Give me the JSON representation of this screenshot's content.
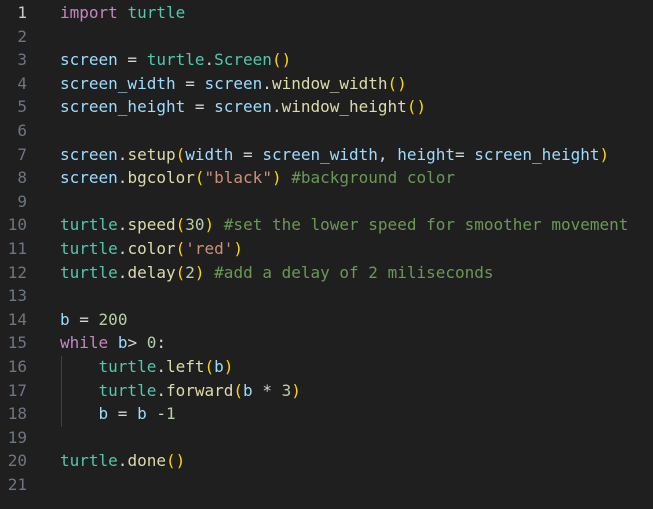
{
  "editor": {
    "language": "python",
    "active_line": 1,
    "colors": {
      "background": "#1f1f1f",
      "line_number": "#6e7681",
      "active_line_number": "#cccccc",
      "keyword": "#c586c0",
      "variable": "#9cdcfe",
      "class": "#4ec9b0",
      "function": "#dcdcaa",
      "bracket_level_1": "#ffd700",
      "bracket_level_2": "#da70d6",
      "string": "#ce9178",
      "number": "#b5cea8",
      "comment": "#6a9955"
    },
    "lines": [
      {
        "n": "1",
        "tokens": [
          [
            "kw",
            "import"
          ],
          [
            "op",
            " "
          ],
          [
            "cls",
            "turtle"
          ]
        ]
      },
      {
        "n": "2",
        "tokens": []
      },
      {
        "n": "3",
        "tokens": [
          [
            "var",
            "screen"
          ],
          [
            "op",
            " = "
          ],
          [
            "cls",
            "turtle"
          ],
          [
            "op",
            "."
          ],
          [
            "cls",
            "Screen"
          ],
          [
            "p1",
            "()"
          ]
        ]
      },
      {
        "n": "4",
        "tokens": [
          [
            "var",
            "screen_width"
          ],
          [
            "op",
            " = "
          ],
          [
            "var",
            "screen"
          ],
          [
            "op",
            "."
          ],
          [
            "fn",
            "window_width"
          ],
          [
            "p1",
            "()"
          ]
        ]
      },
      {
        "n": "5",
        "tokens": [
          [
            "var",
            "screen_height"
          ],
          [
            "op",
            " = "
          ],
          [
            "var",
            "screen"
          ],
          [
            "op",
            "."
          ],
          [
            "fn",
            "window_height"
          ],
          [
            "p1",
            "()"
          ]
        ]
      },
      {
        "n": "6",
        "tokens": []
      },
      {
        "n": "7",
        "tokens": [
          [
            "var",
            "screen"
          ],
          [
            "op",
            "."
          ],
          [
            "fn",
            "setup"
          ],
          [
            "p1",
            "("
          ],
          [
            "var",
            "width"
          ],
          [
            "op",
            " = "
          ],
          [
            "var",
            "screen_width"
          ],
          [
            "op",
            ", "
          ],
          [
            "var",
            "height"
          ],
          [
            "op",
            "= "
          ],
          [
            "var",
            "screen_height"
          ],
          [
            "p1",
            ")"
          ]
        ]
      },
      {
        "n": "8",
        "tokens": [
          [
            "var",
            "screen"
          ],
          [
            "op",
            "."
          ],
          [
            "fn",
            "bgcolor"
          ],
          [
            "p1",
            "("
          ],
          [
            "str",
            "\"black\""
          ],
          [
            "p1",
            ")"
          ],
          [
            "op",
            " "
          ],
          [
            "com",
            "#background color"
          ]
        ]
      },
      {
        "n": "9",
        "tokens": []
      },
      {
        "n": "10",
        "tokens": [
          [
            "cls",
            "turtle"
          ],
          [
            "op",
            "."
          ],
          [
            "fn",
            "speed"
          ],
          [
            "p1",
            "("
          ],
          [
            "num",
            "30"
          ],
          [
            "p1",
            ")"
          ],
          [
            "op",
            " "
          ],
          [
            "com",
            "#set the lower speed for smoother movement"
          ]
        ]
      },
      {
        "n": "11",
        "tokens": [
          [
            "cls",
            "turtle"
          ],
          [
            "op",
            "."
          ],
          [
            "fn",
            "color"
          ],
          [
            "p1",
            "("
          ],
          [
            "str",
            "'red'"
          ],
          [
            "p1",
            ")"
          ]
        ]
      },
      {
        "n": "12",
        "tokens": [
          [
            "cls",
            "turtle"
          ],
          [
            "op",
            "."
          ],
          [
            "fn",
            "delay"
          ],
          [
            "p1",
            "("
          ],
          [
            "num",
            "2"
          ],
          [
            "p1",
            ")"
          ],
          [
            "op",
            " "
          ],
          [
            "com",
            "#add a delay of 2 miliseconds"
          ]
        ]
      },
      {
        "n": "13",
        "tokens": []
      },
      {
        "n": "14",
        "tokens": [
          [
            "var",
            "b"
          ],
          [
            "op",
            " = "
          ],
          [
            "num",
            "200"
          ]
        ]
      },
      {
        "n": "15",
        "tokens": [
          [
            "kw",
            "while"
          ],
          [
            "op",
            " "
          ],
          [
            "var",
            "b"
          ],
          [
            "op",
            "> "
          ],
          [
            "num",
            "0"
          ],
          [
            "op",
            ":"
          ]
        ]
      },
      {
        "n": "16",
        "tokens": [
          [
            "op",
            "    "
          ],
          [
            "cls",
            "turtle"
          ],
          [
            "op",
            "."
          ],
          [
            "fn",
            "left"
          ],
          [
            "p1",
            "("
          ],
          [
            "var",
            "b"
          ],
          [
            "p1",
            ")"
          ]
        ]
      },
      {
        "n": "17",
        "tokens": [
          [
            "op",
            "    "
          ],
          [
            "cls",
            "turtle"
          ],
          [
            "op",
            "."
          ],
          [
            "fn",
            "forward"
          ],
          [
            "p1",
            "("
          ],
          [
            "var",
            "b"
          ],
          [
            "op",
            " * "
          ],
          [
            "num",
            "3"
          ],
          [
            "p1",
            ")"
          ]
        ]
      },
      {
        "n": "18",
        "tokens": [
          [
            "op",
            "    "
          ],
          [
            "var",
            "b"
          ],
          [
            "op",
            " = "
          ],
          [
            "var",
            "b"
          ],
          [
            "op",
            " -"
          ],
          [
            "num",
            "1"
          ]
        ]
      },
      {
        "n": "19",
        "tokens": []
      },
      {
        "n": "20",
        "tokens": [
          [
            "cls",
            "turtle"
          ],
          [
            "op",
            "."
          ],
          [
            "fn",
            "done"
          ],
          [
            "p1",
            "()"
          ]
        ]
      },
      {
        "n": "21",
        "tokens": []
      }
    ]
  }
}
